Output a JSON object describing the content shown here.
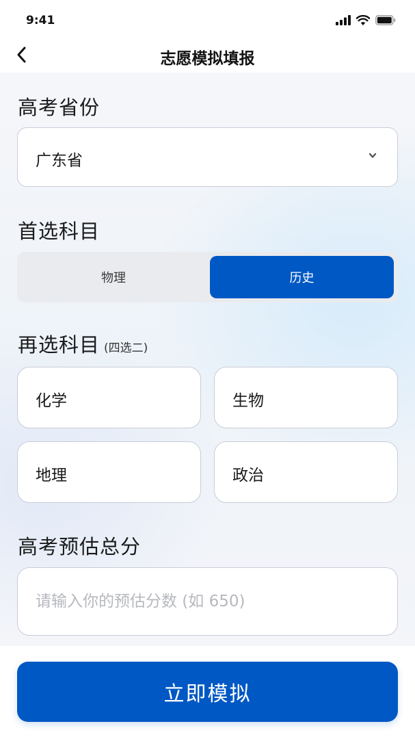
{
  "status_bar": {
    "time": "9:41"
  },
  "nav": {
    "title": "志愿模拟填报"
  },
  "province": {
    "label": "高考省份",
    "selected": "广东省"
  },
  "primary_subject": {
    "label": "首选科目",
    "options": [
      "物理",
      "历史"
    ],
    "selected": "历史"
  },
  "secondary_subjects": {
    "label": "再选科目",
    "hint": "(四选二)",
    "options": [
      "化学",
      "生物",
      "地理",
      "政治"
    ]
  },
  "score": {
    "label": "高考预估总分",
    "placeholder": "请输入你的预估分数 (如 650)",
    "value": ""
  },
  "submit": {
    "label": "立即模拟"
  },
  "colors": {
    "accent": "#0058c4",
    "border": "#c9ccd8"
  }
}
